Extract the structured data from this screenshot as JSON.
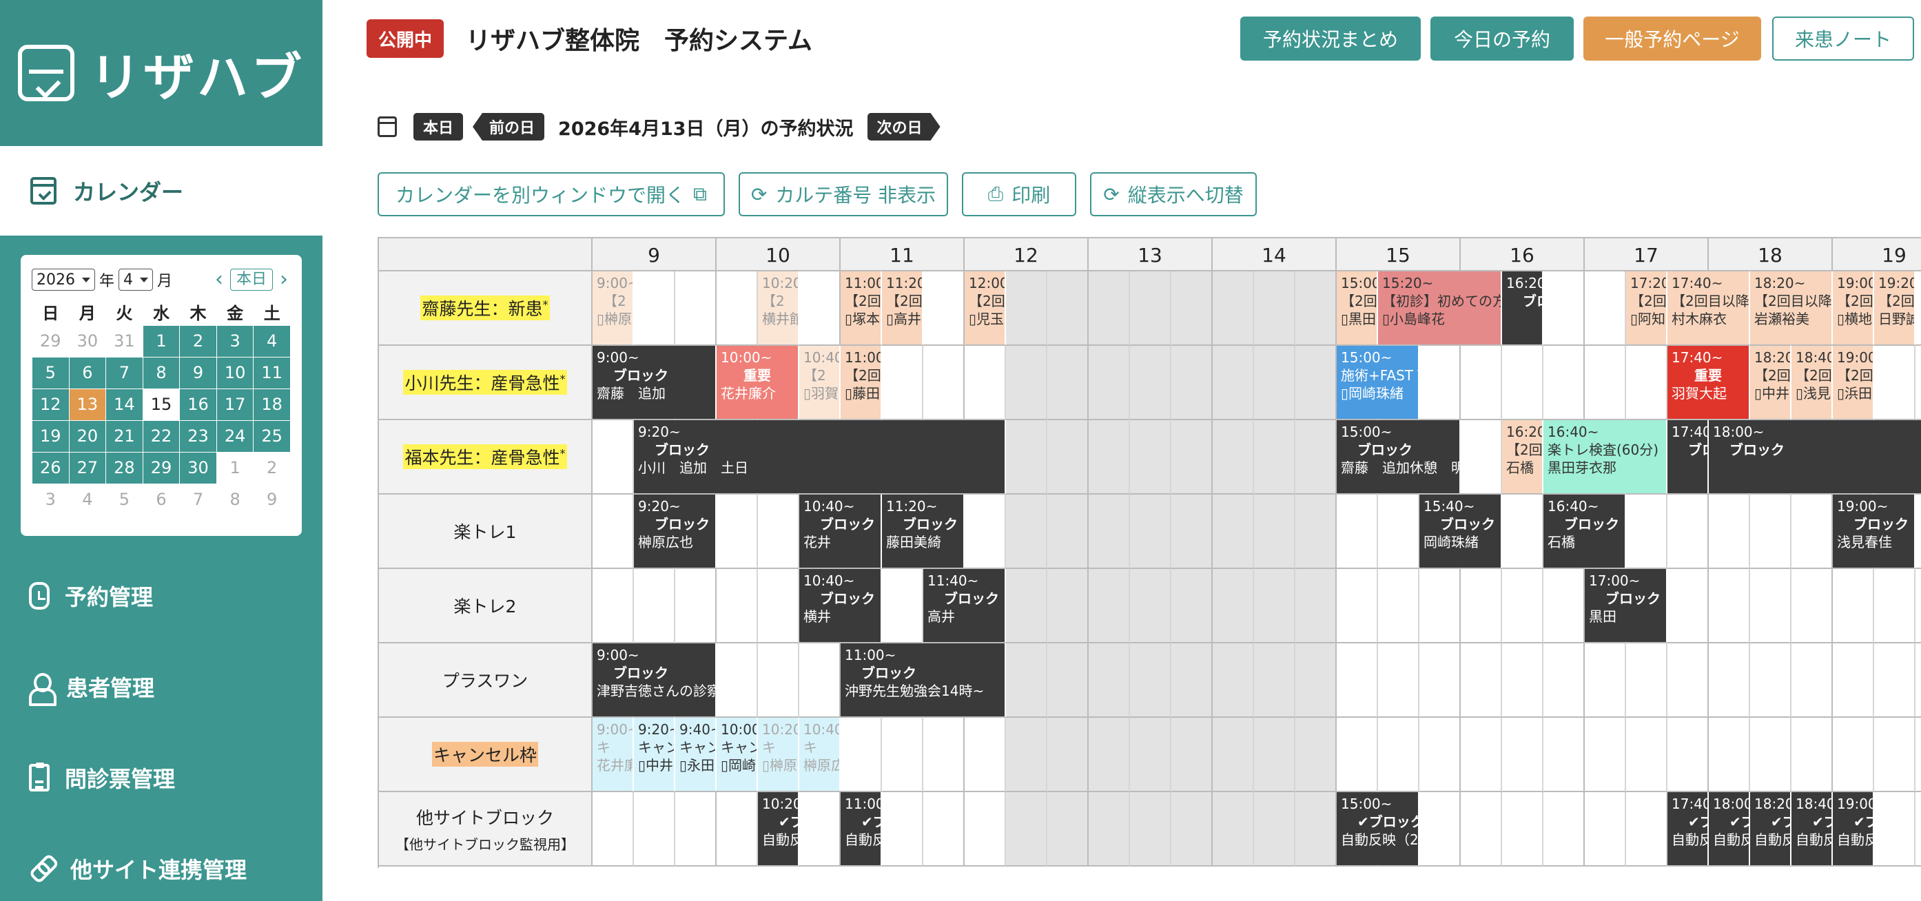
{
  "sidebar": {
    "brand": "リザハブ",
    "calendar_label": "カレンダー",
    "mini_calendar": {
      "year": "2026",
      "year_unit": "年",
      "month": "4",
      "month_unit": "月",
      "today_label": "本日",
      "weekdays": [
        "日",
        "月",
        "火",
        "水",
        "木",
        "金",
        "土"
      ],
      "weeks": [
        [
          [
            "29",
            "out"
          ],
          [
            "30",
            "out"
          ],
          [
            "31",
            "out"
          ],
          [
            "1",
            "on"
          ],
          [
            "2",
            "on"
          ],
          [
            "3",
            "on"
          ],
          [
            "4",
            "on"
          ]
        ],
        [
          [
            "5",
            "on"
          ],
          [
            "6",
            "on"
          ],
          [
            "7",
            "on"
          ],
          [
            "8",
            "on"
          ],
          [
            "9",
            "on"
          ],
          [
            "10",
            "on"
          ],
          [
            "11",
            "on"
          ]
        ],
        [
          [
            "12",
            "on"
          ],
          [
            "13",
            "sel"
          ],
          [
            "14",
            "on"
          ],
          [
            "15",
            "today"
          ],
          [
            "16",
            "on"
          ],
          [
            "17",
            "on"
          ],
          [
            "18",
            "on"
          ]
        ],
        [
          [
            "19",
            "on"
          ],
          [
            "20",
            "on"
          ],
          [
            "21",
            "on"
          ],
          [
            "22",
            "on"
          ],
          [
            "23",
            "on"
          ],
          [
            "24",
            "on"
          ],
          [
            "25",
            "on"
          ]
        ],
        [
          [
            "26",
            "on"
          ],
          [
            "27",
            "on"
          ],
          [
            "28",
            "on"
          ],
          [
            "29",
            "on"
          ],
          [
            "30",
            "on"
          ],
          [
            "1",
            "out"
          ],
          [
            "2",
            "out"
          ]
        ],
        [
          [
            "3",
            "out"
          ],
          [
            "4",
            "out"
          ],
          [
            "5",
            "out"
          ],
          [
            "6",
            "out"
          ],
          [
            "7",
            "out"
          ],
          [
            "8",
            "out"
          ],
          [
            "9",
            "out"
          ]
        ]
      ]
    },
    "items": [
      {
        "label": "予約管理",
        "icon": "watch-icon"
      },
      {
        "label": "患者管理",
        "icon": "user-icon"
      },
      {
        "label": "問診票管理",
        "icon": "clipboard-icon"
      },
      {
        "label": "他サイト連携管理",
        "icon": "link-icon"
      }
    ]
  },
  "header": {
    "status": "公開中",
    "title": "リザハブ整体院　予約システム",
    "buttons": [
      "予約状況まとめ",
      "今日の予約",
      "一般予約ページ",
      "来患ノート"
    ]
  },
  "date_nav": {
    "today": "本日",
    "prev": "前の日",
    "label": "2026年4月13日（月）の予約状況",
    "next": "次の日"
  },
  "tools": [
    {
      "label": "カレンダーを別ウィンドウで開く",
      "icon": "external-link-icon"
    },
    {
      "label": "カルテ番号 非表示",
      "icon": "refresh-icon"
    },
    {
      "label": "印刷",
      "icon": "print-icon"
    },
    {
      "label": "縦表示へ切替",
      "icon": "refresh-icon"
    }
  ],
  "grid": {
    "hours": [
      "9",
      "10",
      "11",
      "12",
      "13",
      "14",
      "15",
      "16",
      "17",
      "18",
      "19"
    ],
    "rows": [
      {
        "label": "齋藤先生：新患",
        "mark": "*",
        "style": "hl"
      },
      {
        "label": "小川先生：産骨急性",
        "mark": "*",
        "style": "hl"
      },
      {
        "label": "福本先生：産骨急性",
        "mark": "*",
        "style": "hl"
      },
      {
        "label": "楽トレ1",
        "style": ""
      },
      {
        "label": "楽トレ2",
        "style": ""
      },
      {
        "label": "プラスワン",
        "style": ""
      },
      {
        "label": "キャンセル枠",
        "style": "hl-or"
      },
      {
        "label": "他サイトブロック",
        "sub": "【他サイトブロック監視用】",
        "style": ""
      }
    ],
    "events": [
      {
        "row": 0,
        "s": 0,
        "n": 1,
        "c": "peach faint",
        "l": [
          "9:00~",
          "　【2",
          "▯榊原"
        ]
      },
      {
        "row": 0,
        "s": 4,
        "n": 1,
        "c": "peach faint",
        "l": [
          "10:20",
          "【2",
          "横井館"
        ]
      },
      {
        "row": 0,
        "s": 6,
        "n": 1,
        "c": "peach",
        "l": [
          "11:00",
          "【2回",
          "▯塚本"
        ]
      },
      {
        "row": 0,
        "s": 7,
        "n": 1,
        "c": "peach",
        "l": [
          "11:20",
          "【2回",
          "▯高井"
        ]
      },
      {
        "row": 0,
        "s": 9,
        "n": 1,
        "c": "peach",
        "l": [
          "12:00",
          "【2回",
          "▯児玉"
        ]
      },
      {
        "row": 0,
        "s": 18,
        "n": 1,
        "c": "peach",
        "l": [
          "15:00",
          "【2回",
          "▯黒田"
        ]
      },
      {
        "row": 0,
        "s": 19,
        "n": 3,
        "c": "pink",
        "l": [
          "15:20~",
          "【初診】初めての方",
          "▯小島峰花"
        ]
      },
      {
        "row": 0,
        "s": 22,
        "n": 1,
        "c": "blk",
        "l": [
          "16:20",
          "ブロッ",
          ""
        ]
      },
      {
        "row": 0,
        "s": 25,
        "n": 1,
        "c": "peach",
        "l": [
          "17:20",
          "【2回",
          "▯阿知"
        ]
      },
      {
        "row": 0,
        "s": 26,
        "n": 2,
        "c": "peach",
        "l": [
          "17:40~",
          "【2回目以降",
          "村木麻衣"
        ]
      },
      {
        "row": 0,
        "s": 28,
        "n": 2,
        "c": "peach",
        "l": [
          "18:20~",
          "【2回目以降",
          "岩瀬裕美"
        ]
      },
      {
        "row": 0,
        "s": 30,
        "n": 1,
        "c": "peach",
        "l": [
          "19:00",
          "【2回",
          "▯横地"
        ]
      },
      {
        "row": 0,
        "s": 31,
        "n": 1,
        "c": "peach",
        "l": [
          "19:20~",
          "【2回目",
          "日野誠"
        ]
      },
      {
        "row": 1,
        "s": 0,
        "n": 3,
        "c": "blk",
        "l": [
          "9:00~",
          "ブロック",
          "齋藤　追加"
        ]
      },
      {
        "row": 1,
        "s": 3,
        "n": 2,
        "c": "salmon",
        "l": [
          "10:00~",
          "重要",
          "花井廉介"
        ]
      },
      {
        "row": 1,
        "s": 5,
        "n": 1,
        "c": "peach faint",
        "l": [
          "10:40",
          "【2",
          "▯羽賀"
        ]
      },
      {
        "row": 1,
        "s": 6,
        "n": 1,
        "c": "peach",
        "l": [
          "11:00",
          "【2回",
          "▯藤田"
        ]
      },
      {
        "row": 1,
        "s": 18,
        "n": 2,
        "c": "blue",
        "l": [
          "15:00~",
          "施術+FAST T",
          "▯岡崎珠緒"
        ]
      },
      {
        "row": 1,
        "s": 26,
        "n": 2,
        "c": "red",
        "l": [
          "17:40~",
          "重要",
          "羽賀大起"
        ]
      },
      {
        "row": 1,
        "s": 28,
        "n": 1,
        "c": "peach",
        "l": [
          "18:20",
          "【2回",
          "▯中井"
        ]
      },
      {
        "row": 1,
        "s": 29,
        "n": 1,
        "c": "peach",
        "l": [
          "18:40",
          "【2回",
          "▯浅見"
        ]
      },
      {
        "row": 1,
        "s": 30,
        "n": 1,
        "c": "peach",
        "l": [
          "19:00",
          "【2回",
          "▯浜田"
        ]
      },
      {
        "row": 2,
        "s": 1,
        "n": 9,
        "c": "blk",
        "l": [
          "9:20~",
          "ブロック",
          "小川　追加　土日"
        ]
      },
      {
        "row": 2,
        "s": 18,
        "n": 3,
        "c": "blk",
        "l": [
          "15:00~",
          "ブロック",
          "齋藤　追加休憩　明"
        ]
      },
      {
        "row": 2,
        "s": 22,
        "n": 1,
        "c": "peach",
        "l": [
          "16:20",
          "【2回",
          "石橋"
        ]
      },
      {
        "row": 2,
        "s": 23,
        "n": 3,
        "c": "mint",
        "l": [
          "16:40~",
          "楽トレ検査(60分)",
          "黒田芽衣那"
        ]
      },
      {
        "row": 2,
        "s": 26,
        "n": 1,
        "c": "blk",
        "l": [
          "17:40",
          "ブロッ",
          ""
        ]
      },
      {
        "row": 2,
        "s": 27,
        "n": 6,
        "c": "blk",
        "l": [
          "18:00~",
          "ブロック",
          ""
        ]
      },
      {
        "row": 3,
        "s": 1,
        "n": 2,
        "c": "blk",
        "l": [
          "9:20~",
          "ブロック",
          "榊原広也"
        ]
      },
      {
        "row": 3,
        "s": 5,
        "n": 2,
        "c": "blk",
        "l": [
          "10:40~",
          "ブロック",
          "花井"
        ]
      },
      {
        "row": 3,
        "s": 7,
        "n": 2,
        "c": "blk",
        "l": [
          "11:20~",
          "ブロック",
          "藤田美綺"
        ]
      },
      {
        "row": 3,
        "s": 20,
        "n": 2,
        "c": "blk",
        "l": [
          "15:40~",
          "ブロック",
          "岡崎珠緒"
        ]
      },
      {
        "row": 3,
        "s": 23,
        "n": 2,
        "c": "blk",
        "l": [
          "16:40~",
          "ブロック",
          "石橋"
        ]
      },
      {
        "row": 3,
        "s": 30,
        "n": 2,
        "c": "blk",
        "l": [
          "19:00~",
          "ブロック",
          "浅見春佳"
        ]
      },
      {
        "row": 4,
        "s": 5,
        "n": 2,
        "c": "blk",
        "l": [
          "10:40~",
          "ブロック",
          "横井"
        ]
      },
      {
        "row": 4,
        "s": 8,
        "n": 2,
        "c": "blk",
        "l": [
          "11:40~",
          "ブロック",
          "高井"
        ]
      },
      {
        "row": 4,
        "s": 24,
        "n": 2,
        "c": "blk",
        "l": [
          "17:00~",
          "ブロック",
          "黒田"
        ]
      },
      {
        "row": 5,
        "s": 0,
        "n": 3,
        "c": "blk",
        "l": [
          "9:00~",
          "ブロック",
          "津野吉徳さんの診察"
        ]
      },
      {
        "row": 5,
        "s": 6,
        "n": 4,
        "c": "blk",
        "l": [
          "11:00~",
          "ブロック",
          "沖野先生勉強会14時~"
        ]
      },
      {
        "row": 6,
        "s": 0,
        "n": 1,
        "c": "cyan faint",
        "l": [
          "9:00~",
          "キ",
          "花井廉"
        ]
      },
      {
        "row": 6,
        "s": 1,
        "n": 1,
        "c": "cyan",
        "l": [
          "9:20~",
          "キャン",
          "▯中井"
        ]
      },
      {
        "row": 6,
        "s": 2,
        "n": 1,
        "c": "cyan",
        "l": [
          "9:40~",
          "キャン",
          "▯永田"
        ]
      },
      {
        "row": 6,
        "s": 3,
        "n": 1,
        "c": "cyan",
        "l": [
          "10:00",
          "キャン",
          "▯岡崎"
        ]
      },
      {
        "row": 6,
        "s": 4,
        "n": 1,
        "c": "cyan faint",
        "l": [
          "10:20",
          "キ",
          "▯榊原"
        ]
      },
      {
        "row": 6,
        "s": 5,
        "n": 1,
        "c": "cyan faint",
        "l": [
          "10:40",
          "キ",
          "榊原広"
        ]
      },
      {
        "row": 7,
        "s": 4,
        "n": 1,
        "c": "blk",
        "l": [
          "10:20",
          "✔ブロ",
          "自動反"
        ]
      },
      {
        "row": 7,
        "s": 6,
        "n": 1,
        "c": "blk",
        "l": [
          "11:00",
          "✔ブロ",
          "自動反"
        ]
      },
      {
        "row": 7,
        "s": 18,
        "n": 2,
        "c": "blk",
        "l": [
          "15:00~",
          "✔ブロック",
          "自動反映（2"
        ]
      },
      {
        "row": 7,
        "s": 26,
        "n": 1,
        "c": "blk",
        "l": [
          "17:40",
          "✔ブロ",
          "自動反"
        ]
      },
      {
        "row": 7,
        "s": 27,
        "n": 1,
        "c": "blk",
        "l": [
          "18:00",
          "✔ブロ",
          "自動反"
        ]
      },
      {
        "row": 7,
        "s": 28,
        "n": 1,
        "c": "blk",
        "l": [
          "18:20",
          "✔ブロ",
          "自動反"
        ]
      },
      {
        "row": 7,
        "s": 29,
        "n": 1,
        "c": "blk",
        "l": [
          "18:40",
          "✔ブロ",
          "自動反"
        ]
      },
      {
        "row": 7,
        "s": 30,
        "n": 1,
        "c": "blk",
        "l": [
          "19:00",
          "✔ブロ",
          "自動反"
        ]
      }
    ]
  }
}
